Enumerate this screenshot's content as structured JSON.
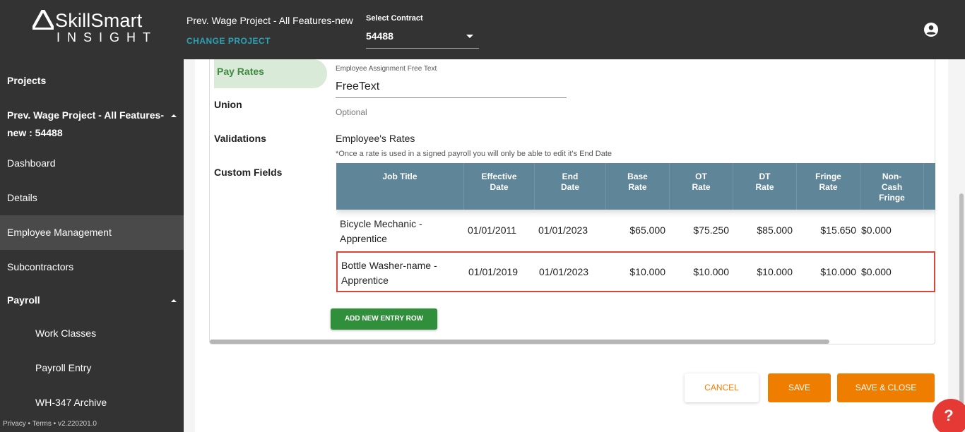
{
  "header": {
    "logo_main": "SkillSmart",
    "logo_sub": "INSIGHT",
    "project_name": "Prev. Wage Project - All Features-new",
    "change_project": "CHANGE PROJECT",
    "contract_label": "Select Contract",
    "contract_value": "54488",
    "user_icon": "account-circle-icon"
  },
  "sidebar": {
    "items": [
      {
        "label": "Projects"
      },
      {
        "label_line1": "Prev. Wage Project - All Features-",
        "label_line2": "new : 54488"
      },
      {
        "label": "Dashboard"
      },
      {
        "label": "Details"
      },
      {
        "label": "Employee Management",
        "active": true
      },
      {
        "label": "Subcontractors"
      },
      {
        "label": "Payroll"
      },
      {
        "label": "Work Classes"
      },
      {
        "label": "Payroll Entry"
      },
      {
        "label": "WH-347 Archive"
      }
    ],
    "footer": "Privacy • Terms • v2.220201.0"
  },
  "tabs": [
    {
      "label": "Pay Rates",
      "active": true
    },
    {
      "label": "Union"
    },
    {
      "label": "Validations"
    },
    {
      "label": "Custom Fields"
    }
  ],
  "assignment": {
    "label": "Employee Assignment Free Text",
    "value": "FreeText",
    "hint": "Optional"
  },
  "rates": {
    "title": "Employee's Rates",
    "note": "*Once a rate is used in a signed payroll you will only be able to edit it's End Date",
    "columns": [
      {
        "line1": "Job Title",
        "line2": "",
        "line3": ""
      },
      {
        "line1": "Effective",
        "line2": "Date",
        "line3": ""
      },
      {
        "line1": "End",
        "line2": "Date",
        "line3": ""
      },
      {
        "line1": "Base",
        "line2": "Rate",
        "line3": ""
      },
      {
        "line1": "OT",
        "line2": "Rate",
        "line3": ""
      },
      {
        "line1": "DT",
        "line2": "Rate",
        "line3": ""
      },
      {
        "line1": "Fringe",
        "line2": "Rate",
        "line3": ""
      },
      {
        "line1": "Non-",
        "line2": "Cash",
        "line3": "Fringe"
      }
    ],
    "rows": [
      {
        "job_line1": "Bicycle Mechanic -",
        "job_line2": "Apprentice",
        "effective": "01/01/2011",
        "end": "01/01/2023",
        "base": "$65.000",
        "ot": "$75.250",
        "dt": "$85.000",
        "fringe": "$15.650",
        "noncash": "$0.000"
      },
      {
        "job_line1": "Bottle Washer-name -",
        "job_line2": "Apprentice",
        "effective": "01/01/2019",
        "end": "01/01/2023",
        "base": "$10.000",
        "ot": "$10.000",
        "dt": "$10.000",
        "fringe": "$10.000",
        "noncash": "$0.000",
        "selected": true
      }
    ],
    "add_row_label": "ADD NEW ENTRY ROW"
  },
  "actions": {
    "cancel": "CANCEL",
    "save": "SAVE",
    "save_close": "SAVE & CLOSE",
    "help": "?"
  },
  "colors": {
    "topbar": "#333333",
    "table_header": "#5f8599",
    "accent_orange": "#ef7d00",
    "add_button": "#2f8f3a",
    "active_tab_bg": "#d9ead9",
    "selected_row_border": "#d9473a"
  }
}
